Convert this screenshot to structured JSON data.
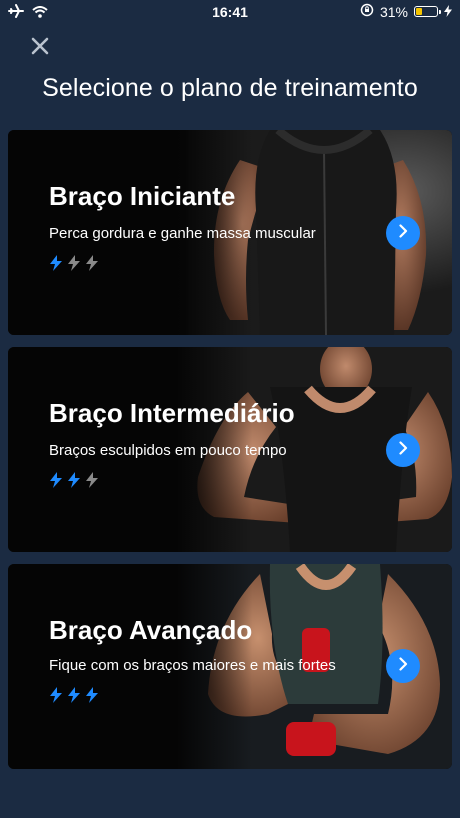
{
  "status_bar": {
    "time": "16:41",
    "battery_text": "31%",
    "battery_level": 0.31,
    "battery_color": "#f5c400",
    "icons": [
      "airplane-icon",
      "wifi-icon",
      "rotation-lock-icon",
      "charging-icon"
    ]
  },
  "header": {
    "close_icon": "close-icon",
    "title": "Selecione o plano de treinamento"
  },
  "plans": [
    {
      "title": "Braço Iniciante",
      "subtitle": "Perca gordura e ganhe massa muscular",
      "level": 1,
      "max_level": 3
    },
    {
      "title": "Braço Intermediário",
      "subtitle": "Braços esculpidos em pouco tempo",
      "level": 2,
      "max_level": 3
    },
    {
      "title": "Braço Avançado",
      "subtitle": "Fique com os braços maiores e mais fortes",
      "level": 3,
      "max_level": 3
    }
  ],
  "colors": {
    "background": "#1b2b42",
    "accent": "#1f8bff",
    "bolt_active": "#1f8bff",
    "bolt_inactive": "#8a8a8a"
  }
}
